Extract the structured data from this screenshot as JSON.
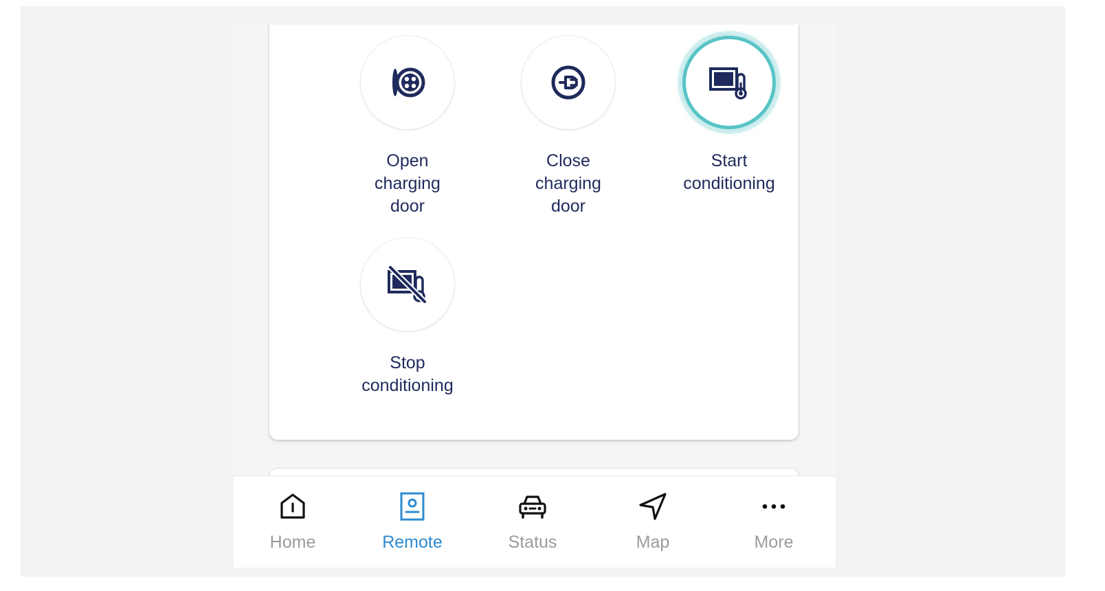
{
  "actions": [
    {
      "id": "open-charging-door",
      "label_lines": [
        "Open",
        "charging",
        "door"
      ],
      "icon": "open-charging-door-icon",
      "active": false
    },
    {
      "id": "close-charging-door",
      "label_lines": [
        "Close",
        "charging",
        "door"
      ],
      "icon": "close-charging-door-icon",
      "active": false
    },
    {
      "id": "start-conditioning",
      "label_lines": [
        "Start",
        "conditioning"
      ],
      "icon": "start-conditioning-icon",
      "active": true
    },
    {
      "id": "stop-conditioning",
      "label_lines": [
        "Stop",
        "conditioning"
      ],
      "icon": "stop-conditioning-icon",
      "active": false
    }
  ],
  "nav": {
    "items": [
      {
        "label": "Home",
        "icon": "home-icon",
        "active": false
      },
      {
        "label": "Remote",
        "icon": "remote-icon",
        "active": true
      },
      {
        "label": "Status",
        "icon": "car-icon",
        "active": false
      },
      {
        "label": "Map",
        "icon": "navigation-arrow-icon",
        "active": false
      },
      {
        "label": "More",
        "icon": "more-dots-icon",
        "active": false
      }
    ]
  },
  "colors": {
    "icon_navy": "#1f2a5c",
    "active_ring": "#58c4c6",
    "nav_active": "#2d8bd0",
    "nav_inactive": "#9b9b9b"
  }
}
